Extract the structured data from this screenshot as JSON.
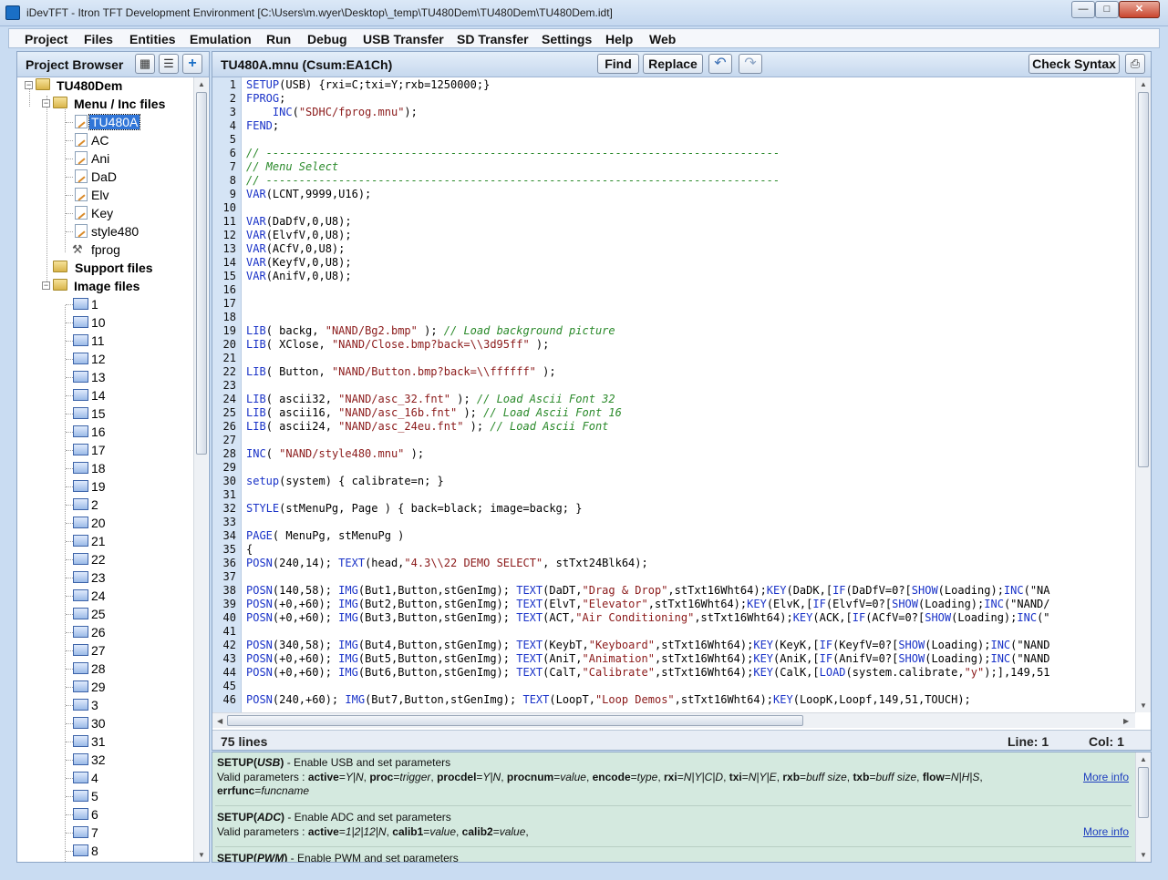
{
  "window": {
    "title": "iDevTFT - Itron TFT Development Environment  [C:\\Users\\m.wyer\\Desktop\\_temp\\TU480Dem\\TU480Dem\\TU480Dem.idt]",
    "min": "—",
    "max": "□",
    "close": "✕"
  },
  "menu": [
    "Project",
    "Files",
    "Entities",
    "Emulation",
    "Run",
    "Debug",
    "USB Transfer",
    "SD Transfer",
    "Settings",
    "Help",
    "Web"
  ],
  "browser": {
    "title": "Project Browser",
    "root": "TU480Dem",
    "menu_folder": "Menu / Inc files",
    "menu_files": [
      "TU480A",
      "AC",
      "Ani",
      "DaD",
      "Elv",
      "Key",
      "style480"
    ],
    "fprog": "fprog",
    "support_folder": "Support files",
    "image_folder": "Image files",
    "images": [
      "1",
      "10",
      "11",
      "12",
      "13",
      "14",
      "15",
      "16",
      "17",
      "18",
      "19",
      "2",
      "20",
      "21",
      "22",
      "23",
      "24",
      "25",
      "26",
      "27",
      "28",
      "29",
      "3",
      "30",
      "31",
      "32",
      "4",
      "5",
      "6",
      "7",
      "8"
    ]
  },
  "editor": {
    "title": "TU480A.mnu  (Csum:EA1Ch)",
    "find": "Find",
    "replace": "Replace",
    "check": "Check Syntax",
    "lines": [
      [
        [
          "SETUP",
          "kw"
        ],
        [
          "(USB) {rxi=C;txi=Y;rxb=1250000;}",
          ""
        ]
      ],
      [
        [
          "FPROG",
          "kw"
        ],
        [
          ";",
          ""
        ]
      ],
      [
        [
          "    ",
          ""
        ],
        [
          "INC",
          "kw"
        ],
        [
          "(",
          ""
        ],
        [
          "\"SDHC/fprog.mnu\"",
          "st"
        ],
        [
          ");",
          ""
        ]
      ],
      [
        [
          "FEND",
          "kw"
        ],
        [
          ";",
          ""
        ]
      ],
      [],
      [
        [
          "// ------------------------------------------------------------------------------",
          "cm"
        ]
      ],
      [
        [
          "// Menu Select",
          "cm"
        ]
      ],
      [
        [
          "// ------------------------------------------------------------------------------",
          "cm"
        ]
      ],
      [
        [
          "VAR",
          "kw"
        ],
        [
          "(LCNT,9999,U16);",
          ""
        ]
      ],
      [],
      [
        [
          "VAR",
          "kw"
        ],
        [
          "(DaDfV,0,U8);",
          ""
        ]
      ],
      [
        [
          "VAR",
          "kw"
        ],
        [
          "(ElvfV,0,U8);",
          ""
        ]
      ],
      [
        [
          "VAR",
          "kw"
        ],
        [
          "(ACfV,0,U8);",
          ""
        ]
      ],
      [
        [
          "VAR",
          "kw"
        ],
        [
          "(KeyfV,0,U8);",
          ""
        ]
      ],
      [
        [
          "VAR",
          "kw"
        ],
        [
          "(AnifV,0,U8);",
          ""
        ]
      ],
      [],
      [],
      [],
      [
        [
          "LIB",
          "kw"
        ],
        [
          "( backg, ",
          ""
        ],
        [
          "\"NAND/Bg2.bmp\"",
          "st"
        ],
        [
          " ); ",
          ""
        ],
        [
          "// Load background picture",
          "cm"
        ]
      ],
      [
        [
          "LIB",
          "kw"
        ],
        [
          "( XClose, ",
          ""
        ],
        [
          "\"NAND/Close.bmp?back=\\\\3d95ff\"",
          "st"
        ],
        [
          " );",
          ""
        ]
      ],
      [],
      [
        [
          "LIB",
          "kw"
        ],
        [
          "( Button, ",
          ""
        ],
        [
          "\"NAND/Button.bmp?back=\\\\ffffff\"",
          "st"
        ],
        [
          " );",
          ""
        ]
      ],
      [],
      [
        [
          "LIB",
          "kw"
        ],
        [
          "( ascii32, ",
          ""
        ],
        [
          "\"NAND/asc_32.fnt\"",
          "st"
        ],
        [
          " ); ",
          ""
        ],
        [
          "// Load Ascii Font 32",
          "cm"
        ]
      ],
      [
        [
          "LIB",
          "kw"
        ],
        [
          "( ascii16, ",
          ""
        ],
        [
          "\"NAND/asc_16b.fnt\"",
          "st"
        ],
        [
          " ); ",
          ""
        ],
        [
          "// Load Ascii Font 16",
          "cm"
        ]
      ],
      [
        [
          "LIB",
          "kw"
        ],
        [
          "( ascii24, ",
          ""
        ],
        [
          "\"NAND/asc_24eu.fnt\"",
          "st"
        ],
        [
          " ); ",
          ""
        ],
        [
          "// Load Ascii Font",
          "cm"
        ]
      ],
      [],
      [
        [
          "INC",
          "kw"
        ],
        [
          "( ",
          ""
        ],
        [
          "\"NAND/style480.mnu\"",
          "st"
        ],
        [
          " );",
          ""
        ]
      ],
      [],
      [
        [
          "setup",
          "kw"
        ],
        [
          "(system) { calibrate=n; }",
          ""
        ]
      ],
      [],
      [
        [
          "STYLE",
          "kw"
        ],
        [
          "(stMenuPg, Page ) { back=black; image=backg; }",
          ""
        ]
      ],
      [],
      [
        [
          "PAGE",
          "kw"
        ],
        [
          "( MenuPg, stMenuPg )",
          ""
        ]
      ],
      [
        [
          "{",
          ""
        ]
      ],
      [
        [
          "POSN",
          "kw"
        ],
        [
          "(240,14); ",
          ""
        ],
        [
          "TEXT",
          "kw"
        ],
        [
          "(head,",
          ""
        ],
        [
          "\"4.3\\\\22 DEMO SELECT\"",
          "st"
        ],
        [
          ", stTxt24Blk64);",
          ""
        ]
      ],
      [],
      [
        [
          "POSN",
          "kw"
        ],
        [
          "(140,58); ",
          ""
        ],
        [
          "IMG",
          "kw"
        ],
        [
          "(But1,Button,stGenImg); ",
          ""
        ],
        [
          "TEXT",
          "kw"
        ],
        [
          "(DaDT,",
          ""
        ],
        [
          "\"Drag & Drop\"",
          "st"
        ],
        [
          ",stTxt16Wht64);",
          ""
        ],
        [
          "KEY",
          "kw"
        ],
        [
          "(DaDK,[",
          ""
        ],
        [
          "IF",
          "kw"
        ],
        [
          "(DaDfV=0?[",
          ""
        ],
        [
          "SHOW",
          "kw"
        ],
        [
          "(Loading);",
          ""
        ],
        [
          "INC",
          "kw"
        ],
        [
          "(\"NA",
          ""
        ]
      ],
      [
        [
          "POSN",
          "kw"
        ],
        [
          "(+0,+60); ",
          ""
        ],
        [
          "IMG",
          "kw"
        ],
        [
          "(But2,Button,stGenImg); ",
          ""
        ],
        [
          "TEXT",
          "kw"
        ],
        [
          "(ElvT,",
          ""
        ],
        [
          "\"Elevator\"",
          "st"
        ],
        [
          ",stTxt16Wht64);",
          ""
        ],
        [
          "KEY",
          "kw"
        ],
        [
          "(ElvK,[",
          ""
        ],
        [
          "IF",
          "kw"
        ],
        [
          "(ElvfV=0?[",
          ""
        ],
        [
          "SHOW",
          "kw"
        ],
        [
          "(Loading);",
          ""
        ],
        [
          "INC",
          "kw"
        ],
        [
          "(\"NAND/",
          ""
        ]
      ],
      [
        [
          "POSN",
          "kw"
        ],
        [
          "(+0,+60); ",
          ""
        ],
        [
          "IMG",
          "kw"
        ],
        [
          "(But3,Button,stGenImg); ",
          ""
        ],
        [
          "TEXT",
          "kw"
        ],
        [
          "(ACT,",
          ""
        ],
        [
          "\"Air Conditioning\"",
          "st"
        ],
        [
          ",stTxt16Wht64);",
          ""
        ],
        [
          "KEY",
          "kw"
        ],
        [
          "(ACK,[",
          ""
        ],
        [
          "IF",
          "kw"
        ],
        [
          "(ACfV=0?[",
          ""
        ],
        [
          "SHOW",
          "kw"
        ],
        [
          "(Loading);",
          ""
        ],
        [
          "INC",
          "kw"
        ],
        [
          "(\"",
          ""
        ]
      ],
      [],
      [
        [
          "POSN",
          "kw"
        ],
        [
          "(340,58); ",
          ""
        ],
        [
          "IMG",
          "kw"
        ],
        [
          "(But4,Button,stGenImg); ",
          ""
        ],
        [
          "TEXT",
          "kw"
        ],
        [
          "(KeybT,",
          ""
        ],
        [
          "\"Keyboard\"",
          "st"
        ],
        [
          ",stTxt16Wht64);",
          ""
        ],
        [
          "KEY",
          "kw"
        ],
        [
          "(KeyK,[",
          ""
        ],
        [
          "IF",
          "kw"
        ],
        [
          "(KeyfV=0?[",
          ""
        ],
        [
          "SHOW",
          "kw"
        ],
        [
          "(Loading);",
          ""
        ],
        [
          "INC",
          "kw"
        ],
        [
          "(\"NAND",
          ""
        ]
      ],
      [
        [
          "POSN",
          "kw"
        ],
        [
          "(+0,+60); ",
          ""
        ],
        [
          "IMG",
          "kw"
        ],
        [
          "(But5,Button,stGenImg); ",
          ""
        ],
        [
          "TEXT",
          "kw"
        ],
        [
          "(AniT,",
          ""
        ],
        [
          "\"Animation\"",
          "st"
        ],
        [
          ",stTxt16Wht64);",
          ""
        ],
        [
          "KEY",
          "kw"
        ],
        [
          "(AniK,[",
          ""
        ],
        [
          "IF",
          "kw"
        ],
        [
          "(AnifV=0?[",
          ""
        ],
        [
          "SHOW",
          "kw"
        ],
        [
          "(Loading);",
          ""
        ],
        [
          "INC",
          "kw"
        ],
        [
          "(\"NAND",
          ""
        ]
      ],
      [
        [
          "POSN",
          "kw"
        ],
        [
          "(+0,+60); ",
          ""
        ],
        [
          "IMG",
          "kw"
        ],
        [
          "(But6,Button,stGenImg); ",
          ""
        ],
        [
          "TEXT",
          "kw"
        ],
        [
          "(CalT,",
          ""
        ],
        [
          "\"Calibrate\"",
          "st"
        ],
        [
          ",stTxt16Wht64);",
          ""
        ],
        [
          "KEY",
          "kw"
        ],
        [
          "(CalK,[",
          ""
        ],
        [
          "LOAD",
          "kw"
        ],
        [
          "(system.calibrate,",
          ""
        ],
        [
          "\"y\"",
          "st"
        ],
        [
          ");],149,51",
          ""
        ]
      ],
      [],
      [
        [
          "POSN",
          "kw"
        ],
        [
          "(240,+60); ",
          ""
        ],
        [
          "IMG",
          "kw"
        ],
        [
          "(But7,Button,stGenImg); ",
          ""
        ],
        [
          "TEXT",
          "kw"
        ],
        [
          "(LoopT,",
          ""
        ],
        [
          "\"Loop Demos\"",
          "st"
        ],
        [
          ",stTxt16Wht64);",
          ""
        ],
        [
          "KEY",
          "kw"
        ],
        [
          "(LoopK,Loopf,149,51,TOUCH);",
          ""
        ]
      ]
    ]
  },
  "status": {
    "lines": "75 lines",
    "line": "Line: 1",
    "col": "Col: 1"
  },
  "help": [
    {
      "name": "SETUP(",
      "arg": "USB",
      "close": ")",
      "desc": " - Enable USB and set parameters",
      "params": [
        [
          "Valid parameters : ",
          ""
        ],
        [
          "active",
          "b"
        ],
        [
          "=",
          ""
        ],
        [
          "Y|N",
          "i"
        ],
        [
          ", ",
          ""
        ],
        [
          "proc",
          "b"
        ],
        [
          "=",
          ""
        ],
        [
          "trigger",
          "i"
        ],
        [
          ", ",
          ""
        ],
        [
          "procdel",
          "b"
        ],
        [
          "=",
          ""
        ],
        [
          "Y|N",
          "i"
        ],
        [
          ", ",
          ""
        ],
        [
          "procnum",
          "b"
        ],
        [
          "=",
          ""
        ],
        [
          "value",
          "i"
        ],
        [
          ", ",
          ""
        ],
        [
          "encode",
          "b"
        ],
        [
          "=",
          ""
        ],
        [
          "type",
          "i"
        ],
        [
          ", ",
          ""
        ],
        [
          "rxi",
          "b"
        ],
        [
          "=",
          ""
        ],
        [
          "N|Y|C|D",
          "i"
        ],
        [
          ", ",
          ""
        ],
        [
          "txi",
          "b"
        ],
        [
          "=",
          ""
        ],
        [
          "N|Y|E",
          "i"
        ],
        [
          ", ",
          ""
        ],
        [
          "rxb",
          "b"
        ],
        [
          "=",
          ""
        ],
        [
          "buff size",
          "i"
        ],
        [
          ", ",
          ""
        ],
        [
          "txb",
          "b"
        ],
        [
          "=",
          ""
        ],
        [
          "buff size",
          "i"
        ],
        [
          ", ",
          ""
        ],
        [
          "flow",
          "b"
        ],
        [
          "=",
          ""
        ],
        [
          "N|H|S",
          "i"
        ],
        [
          ",",
          ""
        ]
      ],
      "params2": [
        [
          "errfunc",
          "b"
        ],
        [
          "=",
          ""
        ],
        [
          "funcname",
          "i"
        ]
      ],
      "more": "More info"
    },
    {
      "name": "SETUP(",
      "arg": "ADC",
      "close": ")",
      "desc": " - Enable ADC and set parameters",
      "params": [
        [
          "Valid parameters : ",
          ""
        ],
        [
          "active",
          "b"
        ],
        [
          "=",
          ""
        ],
        [
          "1|2|12|N",
          "i"
        ],
        [
          ", ",
          ""
        ],
        [
          "calib1",
          "b"
        ],
        [
          "=",
          ""
        ],
        [
          "value",
          "i"
        ],
        [
          ", ",
          ""
        ],
        [
          "calib2",
          "b"
        ],
        [
          "=",
          ""
        ],
        [
          "value",
          "i"
        ],
        [
          ",",
          ""
        ]
      ],
      "params2": [],
      "more": "More info"
    },
    {
      "name": "SETUP(",
      "arg": "PWM",
      "close": ")",
      "desc": " - Enable PWM and set parameters",
      "params": [],
      "params2": [],
      "more": ""
    }
  ]
}
